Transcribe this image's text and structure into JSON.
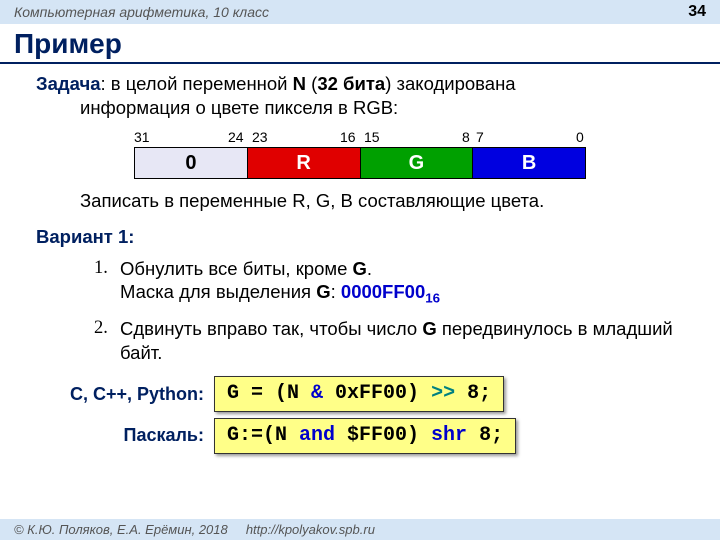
{
  "header": {
    "course": "Компьютерная арифметика, 10 класс",
    "page": "34"
  },
  "title": "Пример",
  "task": {
    "label": "Задача",
    "text1": ":  в целой переменной ",
    "var": "N",
    "text2": " (",
    "bits": "32 бита",
    "text3": ") закодирована",
    "line2": "информация о цвете пикселя в RGB:"
  },
  "bits": {
    "labels": [
      "31",
      "24",
      "23",
      "16",
      "15",
      "8",
      "7",
      "0"
    ],
    "boxes": [
      "0",
      "R",
      "G",
      "B"
    ]
  },
  "subtask": "Записать в переменные R, G, B составляющие цвета.",
  "variant": "Вариант 1",
  "steps": {
    "s1a": "Обнулить все биты, кроме ",
    "s1g": "G",
    "s1b": ".",
    "s1c": "Маска для выделения ",
    "s1d": ": ",
    "mask": "0000FF00",
    "masksub": "16",
    "s2a": "Сдвинуть вправо так, чтобы число ",
    "s2g": "G",
    "s2b": " передвинулось в младший байт."
  },
  "code": {
    "lang1": "C, C++, Python:",
    "lang2": "Паскаль:",
    "c_pre": "G = (N ",
    "c_and": "&",
    "c_mid": " 0xFF00) ",
    "c_shr": ">>",
    "c_post": " 8;",
    "p_pre": "G:=(N ",
    "p_and": "and",
    "p_mid": " $FF00) ",
    "p_shr": "shr",
    "p_post": " 8;"
  },
  "footer": {
    "credit": "© К.Ю. Поляков, Е.А. Ерёмин, 2018",
    "url": "http://kpolyakov.spb.ru"
  }
}
